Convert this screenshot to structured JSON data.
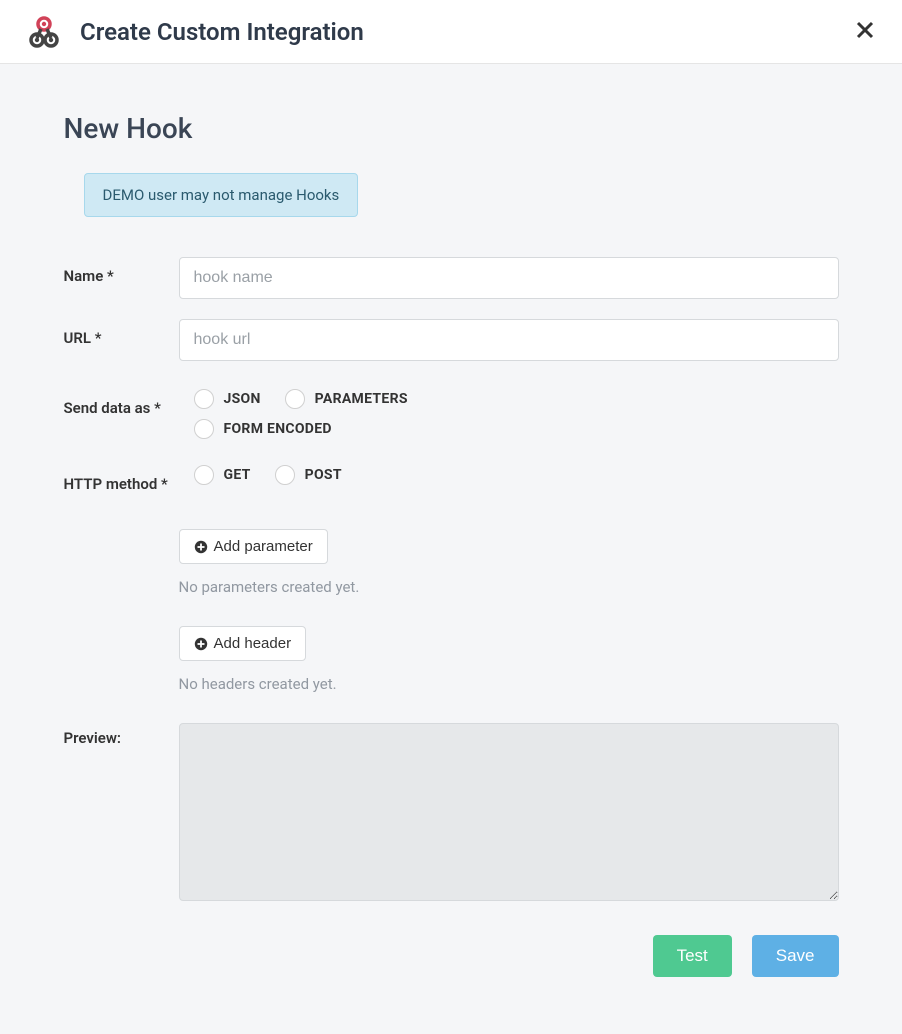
{
  "header": {
    "title": "Create Custom Integration"
  },
  "page": {
    "title": "New Hook"
  },
  "alert": {
    "text": "DEMO user may not manage Hooks"
  },
  "form": {
    "name": {
      "label": "Name *",
      "placeholder": "hook name",
      "value": ""
    },
    "url": {
      "label": "URL *",
      "placeholder": "hook url",
      "value": ""
    },
    "data_format": {
      "label": "Send data as *",
      "options": {
        "json": "JSON",
        "parameters": "PARAMETERS",
        "form_encoded": "FORM ENCODED"
      }
    },
    "http_method": {
      "label": "HTTP method *",
      "options": {
        "get": "GET",
        "post": "POST"
      }
    },
    "parameters": {
      "add_label": "Add parameter",
      "empty_text": "No parameters created yet."
    },
    "headers": {
      "add_label": "Add header",
      "empty_text": "No headers created yet."
    },
    "preview": {
      "label": "Preview:",
      "value": ""
    }
  },
  "buttons": {
    "test": "Test",
    "save": "Save"
  }
}
